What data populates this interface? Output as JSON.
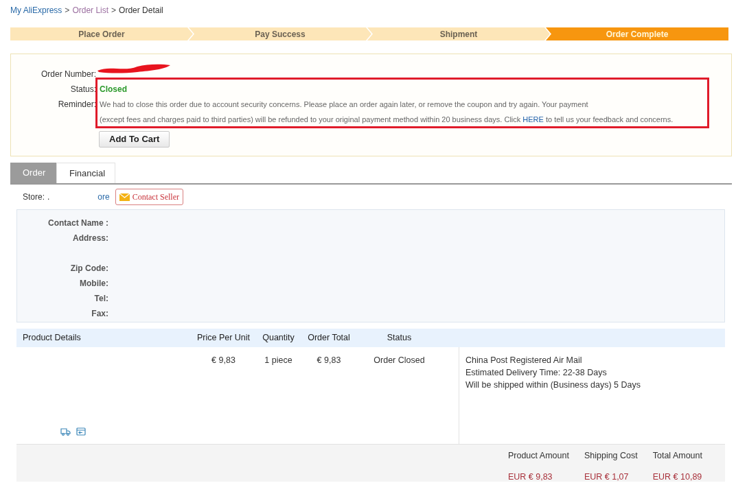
{
  "breadcrumb": [
    {
      "label": "My AliExpress",
      "kind": "link"
    },
    {
      "label": ">",
      "kind": "separator"
    },
    {
      "label": "Order List",
      "kind": "visited"
    },
    {
      "label": ">",
      "kind": "separator"
    },
    {
      "label": "Order Detail",
      "kind": "current"
    }
  ],
  "steps": [
    {
      "label": "Place Order",
      "selected": false
    },
    {
      "label": "Pay Success",
      "selected": false
    },
    {
      "label": "Shipment",
      "selected": false
    },
    {
      "label": "Order Complete",
      "selected": true
    }
  ],
  "order_info": {
    "order_number_label": "Order Number:",
    "status_label": "Status:",
    "status": "Closed",
    "reminder_label": "Reminder:",
    "reminder_line_1": "We had to close this order due to account security concerns. Please place an order again later, or remove the coupon and try again. Your payment",
    "reminder_line_2_before": "(except fees and charges paid to third parties) will be refunded to your original payment method within 20 business days. Click",
    "reminder_link": "HERE",
    "reminder_line_2_after": "to tell us your feedback and concerns.",
    "add_to_cart": "Add To Cart"
  },
  "tabs": [
    {
      "label": "Order",
      "selected": true
    },
    {
      "label": "Financial",
      "selected": false
    }
  ],
  "store": {
    "label": "Store:",
    "name_start": ".",
    "name_end": "ore",
    "contact_seller": "Contact Seller"
  },
  "address": [
    {
      "label": "Contact Name :"
    },
    {
      "label": "Address:",
      "tall": true
    },
    {
      "label": "Zip Code:"
    },
    {
      "label": "Mobile:"
    },
    {
      "label": "Tel:"
    },
    {
      "label": "Fax:"
    }
  ],
  "table": {
    "columns": [
      "Product Details",
      "Price Per Unit",
      "Quantity",
      "Order Total",
      "Status"
    ],
    "row": {
      "price": "€ 9,83",
      "quantity": "1 piece",
      "total": "€ 9,83",
      "status": "Order Closed"
    },
    "shipping": [
      "China Post Registered Air Mail",
      "Estimated Delivery Time: 22-38 Days",
      "Will be shipped within (Business days) 5 Days"
    ]
  },
  "summary": [
    {
      "label": "Product Amount",
      "value": "EUR € 9,83"
    },
    {
      "label": "Shipping Cost",
      "value": "EUR € 1,07"
    },
    {
      "label": "Total Amount",
      "value": "EUR € 10,89"
    }
  ]
}
